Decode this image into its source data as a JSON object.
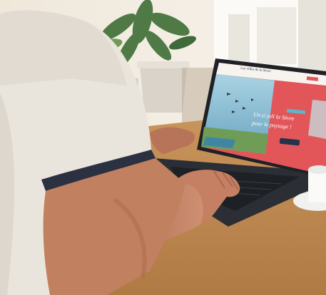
{
  "scene": {
    "subject": "person-using-laptop",
    "colors": {
      "wall": "#f3ede2",
      "window_light": "#fbfaf6",
      "shirt": "#e9e4dc",
      "shirt_trim": "#2b3140",
      "skin": "#c7876a",
      "laptop_body": "#2a2d33",
      "screen_accent": "#e2565a",
      "screen_sky": "#8fc1d6",
      "table": "#c99a62",
      "plant": "#4f7a45"
    }
  },
  "laptop_screen": {
    "site_logo_text": "Les villes de la Sèvre",
    "headline_line1": "Un si joli la Sèvre",
    "headline_line2": "pour le paysage !"
  }
}
